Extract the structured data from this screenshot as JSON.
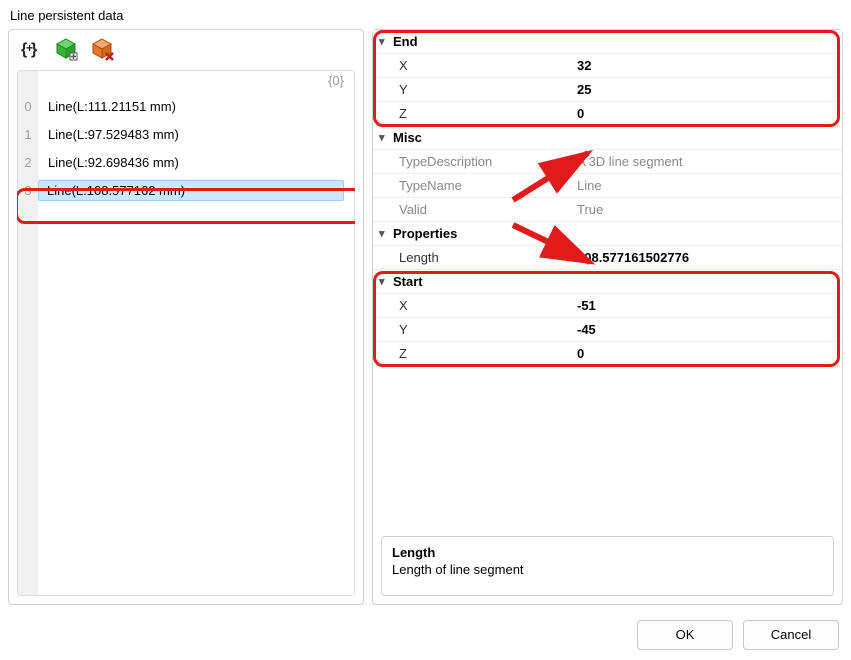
{
  "title": "Line persistent data",
  "list": {
    "group_label": "{0}",
    "items": [
      {
        "index": "0",
        "label": "Line(L:111.21151 mm)"
      },
      {
        "index": "1",
        "label": "Line(L:97.529483 mm)"
      },
      {
        "index": "2",
        "label": "Line(L:92.698436 mm)"
      },
      {
        "index": "3",
        "label": "Line(L:108.577162 mm)"
      }
    ],
    "selected_index": 3
  },
  "properties": {
    "end": {
      "label": "End",
      "X": "32",
      "Y": "25",
      "Z": "0"
    },
    "misc": {
      "label": "Misc",
      "typeDescription_label": "TypeDescription",
      "typeDescription": "A 3D line segment",
      "typeName_label": "TypeName",
      "typeName": "Line",
      "valid_label": "Valid",
      "valid": "True"
    },
    "props": {
      "label": "Properties",
      "length_label": "Length",
      "length": "108.577161502776"
    },
    "start": {
      "label": "Start",
      "X": "-51",
      "Y": "-45",
      "Z": "0"
    }
  },
  "help": {
    "title": "Length",
    "description": "Length of line segment"
  },
  "buttons": {
    "ok": "OK",
    "cancel": "Cancel"
  },
  "axis": {
    "x": "X",
    "y": "Y",
    "z": "Z"
  }
}
